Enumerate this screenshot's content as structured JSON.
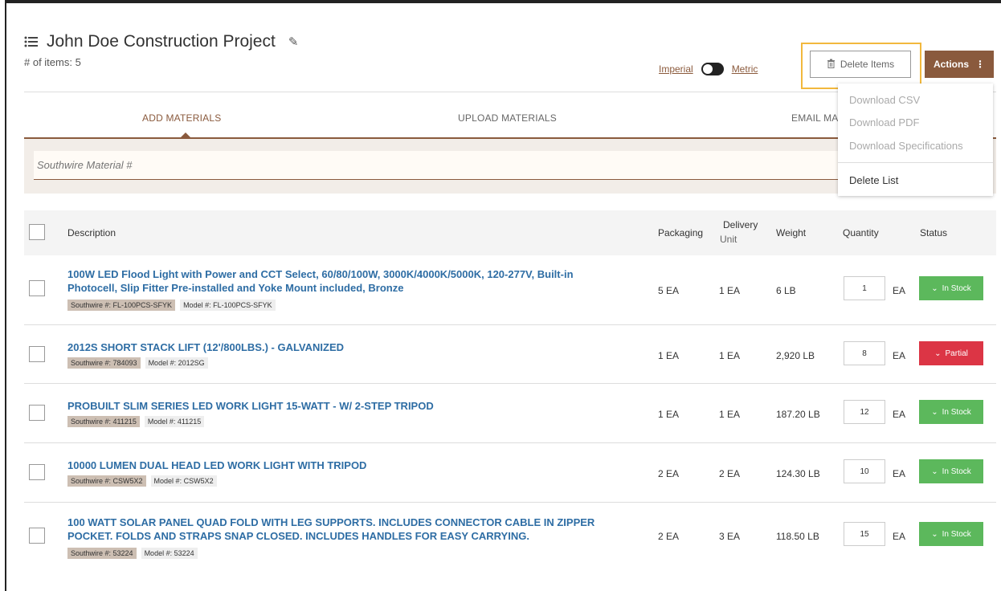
{
  "header": {
    "title": "John Doe Construction Project",
    "item_count": "# of items: 5"
  },
  "units": {
    "imperial": "Imperial",
    "metric": "Metric"
  },
  "toolbar": {
    "delete_label": "Delete Items",
    "actions_label": "Actions"
  },
  "tabs": [
    {
      "label": "ADD MATERIALS"
    },
    {
      "label": "UPLOAD MATERIALS"
    },
    {
      "label": "EMAIL MA"
    }
  ],
  "search": {
    "placeholder": "Southwire Material #"
  },
  "actions_menu": {
    "items": [
      {
        "label": "Download CSV"
      },
      {
        "label": "Download PDF"
      },
      {
        "label": "Download Specifications"
      },
      {
        "label": "Delete List"
      }
    ]
  },
  "table": {
    "headers": {
      "description": "Description",
      "packaging": "Packaging",
      "delivery_1": "Delivery",
      "delivery_2": "Unit",
      "weight": "Weight",
      "quantity": "Quantity",
      "status": "Status"
    },
    "rows": [
      {
        "desc_1": "100W LED Flood Light with Power and CCT Select, 60/80/100W, 3000K/4000K/5000K, 120-277V, Built-in",
        "desc_2": "Photocell, Slip Fitter Pre-installed and Yoke Mount included, Bronze",
        "sw": "Southwire #: FL-100PCS-SFYK",
        "model": "Model #: FL-100PCS-SFYK",
        "packaging": "5 EA",
        "delivery": "1 EA",
        "weight": "6 LB",
        "qty": "1",
        "unit": "EA",
        "status": "In Stock"
      },
      {
        "desc_1": "2012S SHORT STACK LIFT (12'/800LBS.) - GALVANIZED",
        "desc_2": "",
        "sw": "Southwire #: 784093",
        "model": "Model #: 2012SG",
        "packaging": "1 EA",
        "delivery": "1 EA",
        "weight": "2,920 LB",
        "qty": "8",
        "unit": "EA",
        "status": "Partial"
      },
      {
        "desc_1": "PROBUILT SLIM SERIES LED WORK LIGHT 15-WATT - W/ 2-STEP TRIPOD",
        "desc_2": "",
        "sw": "Southwire #: 411215",
        "model": "Model #: 411215",
        "packaging": "1 EA",
        "delivery": "1 EA",
        "weight": "187.20 LB",
        "qty": "12",
        "unit": "EA",
        "status": "In Stock"
      },
      {
        "desc_1": "10000 LUMEN DUAL HEAD LED WORK LIGHT WITH TRIPOD",
        "desc_2": "",
        "sw": "Southwire #: CSW5X2",
        "model": "Model #: CSW5X2",
        "packaging": "2 EA",
        "delivery": "2 EA",
        "weight": "124.30 LB",
        "qty": "10",
        "unit": "EA",
        "status": "In Stock"
      },
      {
        "desc_1": "100 WATT SOLAR PANEL QUAD FOLD WITH LEG SUPPORTS. INCLUDES CONNECTOR CABLE IN ZIPPER",
        "desc_2": "POCKET. FOLDS AND STRAPS SNAP CLOSED. INCLUDES HANDLES FOR EASY CARRYING.",
        "sw": "Southwire #: 53224",
        "model": "Model #: 53224",
        "packaging": "2 EA",
        "delivery": "3 EA",
        "weight": "118.50 LB",
        "qty": "15",
        "unit": "EA",
        "status": "In Stock"
      }
    ]
  },
  "colors": {
    "brand": "#8a5a3d",
    "link": "#2e6da4",
    "in_stock": "#5cb85c",
    "partial": "#dc3545",
    "highlight": "#f2b83d"
  }
}
